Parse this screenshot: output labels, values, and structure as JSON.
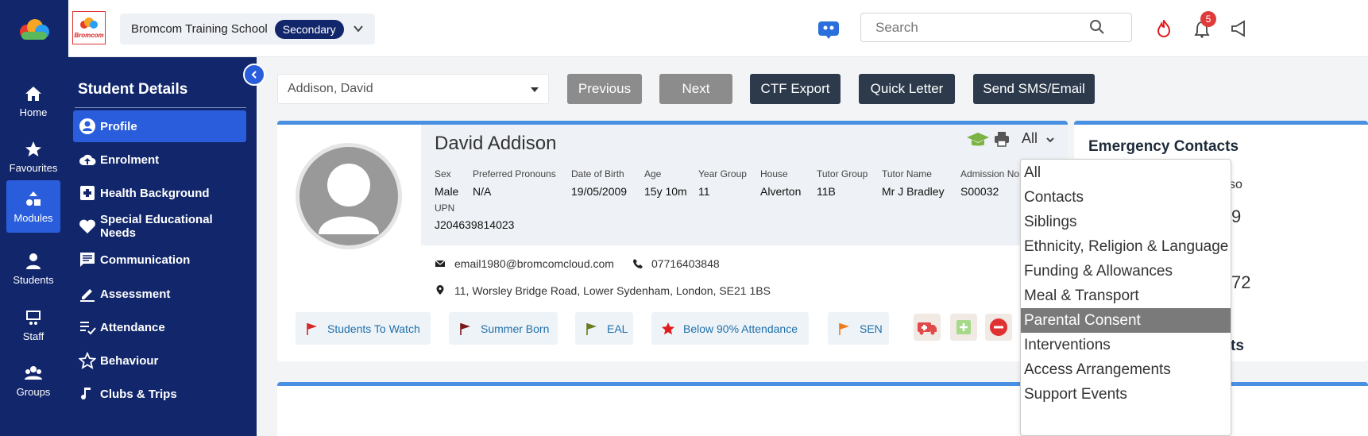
{
  "rail": {
    "items": [
      {
        "label": "Home"
      },
      {
        "label": "Favourites"
      },
      {
        "label": "Modules"
      },
      {
        "label": "Students"
      },
      {
        "label": "Staff"
      },
      {
        "label": "Groups"
      }
    ]
  },
  "topbar": {
    "logo_text": "Bromcom",
    "school_name": "Bromcom Training School",
    "school_phase": "Secondary",
    "search_placeholder": "Search",
    "notification_count": "5"
  },
  "side": {
    "title": "Student Details",
    "items": [
      {
        "label": "Profile"
      },
      {
        "label": "Enrolment"
      },
      {
        "label": "Health Background"
      },
      {
        "label": "Special Educational Needs"
      },
      {
        "label": "Communication"
      },
      {
        "label": "Assessment"
      },
      {
        "label": "Attendance"
      },
      {
        "label": "Behaviour"
      },
      {
        "label": "Clubs & Trips"
      }
    ]
  },
  "toolbar": {
    "student_selected": "Addison, David",
    "previous_label": "Previous",
    "next_label": "Next",
    "ctf_label": "CTF Export",
    "quick_letter_label": "Quick Letter",
    "sms_label": "Send SMS/Email"
  },
  "student": {
    "name": "David Addison",
    "fields": [
      {
        "label": "Sex",
        "value": "Male"
      },
      {
        "label": "Preferred Pronouns",
        "value": "N/A"
      },
      {
        "label": "Date of Birth",
        "value": "19/05/2009"
      },
      {
        "label": "Age",
        "value": "15y 10m"
      },
      {
        "label": "Year Group",
        "value": "11"
      },
      {
        "label": "House",
        "value": "Alverton"
      },
      {
        "label": "Tutor Group",
        "value": "11B"
      },
      {
        "label": "Tutor Name",
        "value": "Mr J Bradley"
      },
      {
        "label": "Admission No",
        "value": "S00032"
      },
      {
        "label": "UPN",
        "value": "J204639814023"
      }
    ],
    "email": "email1980@bromcomcloud.com",
    "phone": "07716403848",
    "address": "11, Worsley Bridge Road, Lower Sydenham, London, SE21 1BS",
    "view_filter": "All"
  },
  "flags": [
    {
      "label": "Students To Watch",
      "color": "#d62828"
    },
    {
      "label": "Summer Born",
      "color": "#7a1a1a"
    },
    {
      "label": "EAL",
      "color": "#6b7a1a"
    },
    {
      "label": "Below 90% Attendance",
      "color": "#e01b1b"
    },
    {
      "label": "SEN",
      "color": "#f07b1a"
    }
  ],
  "emergency": {
    "title": "Emergency Contacts",
    "frag1": "so",
    "frag2": "9",
    "frag3": "72",
    "frag4": "ts"
  },
  "dropdown": {
    "items": [
      {
        "label": "All"
      },
      {
        "label": "Contacts"
      },
      {
        "label": "Siblings"
      },
      {
        "label": "Ethnicity, Religion & Language"
      },
      {
        "label": "Funding & Allowances"
      },
      {
        "label": "Meal & Transport"
      },
      {
        "label": "Parental Consent"
      },
      {
        "label": "Interventions"
      },
      {
        "label": "Access Arrangements"
      },
      {
        "label": "Support Events"
      }
    ],
    "selected": "Parental Consent"
  },
  "colors": {
    "rail": "#12276b",
    "accent": "#2a5ddb",
    "card_border": "#4a90e2",
    "button_dark": "#2c3a4b"
  }
}
